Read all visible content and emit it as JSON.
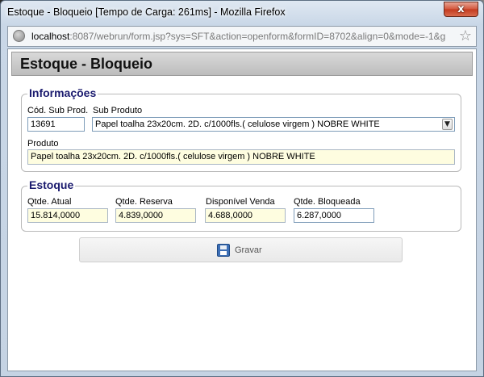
{
  "window": {
    "title": "Estoque - Bloqueio [Tempo de Carga: 261ms] - Mozilla Firefox",
    "close_symbol": "x",
    "url_host": "localhost",
    "url_rest": ":8087/webrun/form.jsp?sys=SFT&action=openform&formID=8702&align=0&mode=-1&g"
  },
  "page": {
    "title": "Estoque - Bloqueio"
  },
  "informacoes": {
    "legend": "Informações",
    "cod_sub_prod_label": "Cód. Sub Prod.",
    "cod_sub_prod_value": "13691",
    "sub_produto_label": "Sub Produto",
    "sub_produto_value": "Papel toalha 23x20cm. 2D. c/1000fls.( celulose virgem ) NOBRE WHITE",
    "produto_label": "Produto",
    "produto_value": "Papel toalha 23x20cm. 2D. c/1000fls.( celulose virgem ) NOBRE WHITE"
  },
  "estoque": {
    "legend": "Estoque",
    "qtde_atual_label": "Qtde. Atual",
    "qtde_atual_value": "15.814,0000",
    "qtde_reserva_label": "Qtde. Reserva",
    "qtde_reserva_value": "4.839,0000",
    "disponivel_venda_label": "Disponível Venda",
    "disponivel_venda_value": "4.688,0000",
    "qtde_bloqueada_label": "Qtde. Bloqueada",
    "qtde_bloqueada_value": "6.287,0000"
  },
  "actions": {
    "save_label": "Gravar"
  },
  "icons": {
    "browser": "globe-icon",
    "bookmark": "star-icon",
    "save": "floppy-disk-icon",
    "dropdown": "chevron-down-icon"
  },
  "colors": {
    "legend": "#1a1a6e",
    "readonly_field": "#fefde0"
  }
}
